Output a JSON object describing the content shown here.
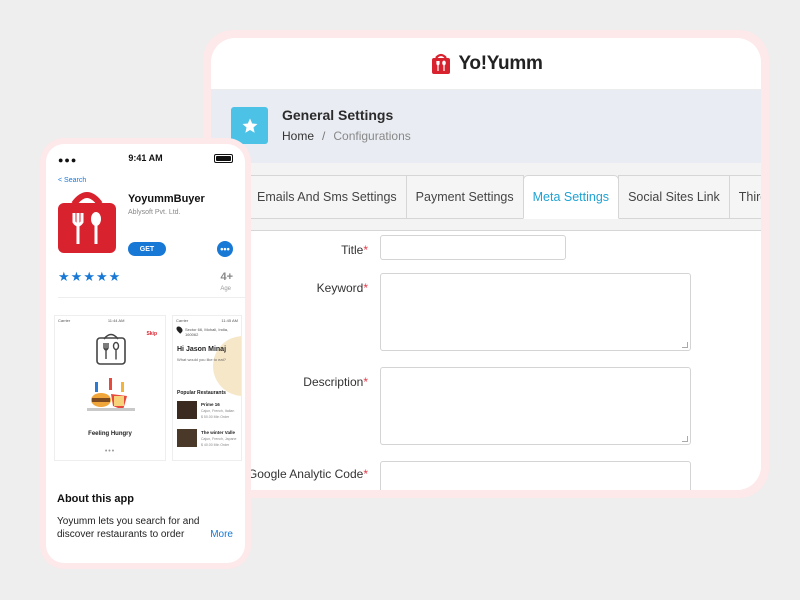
{
  "admin": {
    "brand": "Yo!Yumm",
    "page_title": "General Settings",
    "breadcrumb": {
      "home": "Home",
      "separator": "/",
      "current": "Configurations"
    },
    "tabs": [
      {
        "label": "Emails And Sms Settings",
        "active": false
      },
      {
        "label": "Payment Settings",
        "active": false
      },
      {
        "label": "Meta Settings",
        "active": true
      },
      {
        "label": "Social Sites Link",
        "active": false
      },
      {
        "label": "Third Part",
        "active": false
      }
    ],
    "form": {
      "title_label": "Title",
      "keyword_label": "Keyword",
      "description_label": "Description",
      "analytics_label": "Google Analytic Code",
      "required_mark": "*",
      "title_value": "",
      "keyword_value": "",
      "description_value": "",
      "analytics_value": ""
    },
    "colors": {
      "accent": "#1fa3d3",
      "tile": "#4cc2e7",
      "required": "#e23a4a",
      "brand_red": "#d8232f"
    }
  },
  "phone": {
    "status": {
      "dots": "●●●",
      "time": "9:41 AM"
    },
    "back_label": "< Search",
    "app_name": "YoyummBuyer",
    "developer": "Ablysoft Pvt. Ltd.",
    "get_label": "GET",
    "more_label": "•••",
    "rating_stars": 5,
    "age_rating": "4+",
    "age_label": "Age",
    "screenshot1": {
      "carrier": "Carrier",
      "time": "11:44 AM",
      "skip": "Skip",
      "caption": "Feeling Hungry",
      "pager": "•••"
    },
    "screenshot2": {
      "carrier": "Carrier",
      "time": "11:45 AM",
      "address": "Sector 66, Mohali, India, 160062",
      "greeting": "Hi Jason Minaj",
      "prompt": "What would you like to eat?",
      "section": "Popular Restaurants",
      "restaurants": [
        {
          "name": "Prime 16",
          "cuisine": "Cajun, French, Italian",
          "price": "$ 50.00 Min Order"
        },
        {
          "name": "The winter Valle",
          "cuisine": "Cajun, French, Japane",
          "price": "$ 40.00 Min Order"
        }
      ]
    },
    "about_title": "About this app",
    "about_desc": "Yoyumm lets you search for and discover restaurants to order",
    "about_more": "More",
    "colors": {
      "link": "#1778d6"
    }
  }
}
